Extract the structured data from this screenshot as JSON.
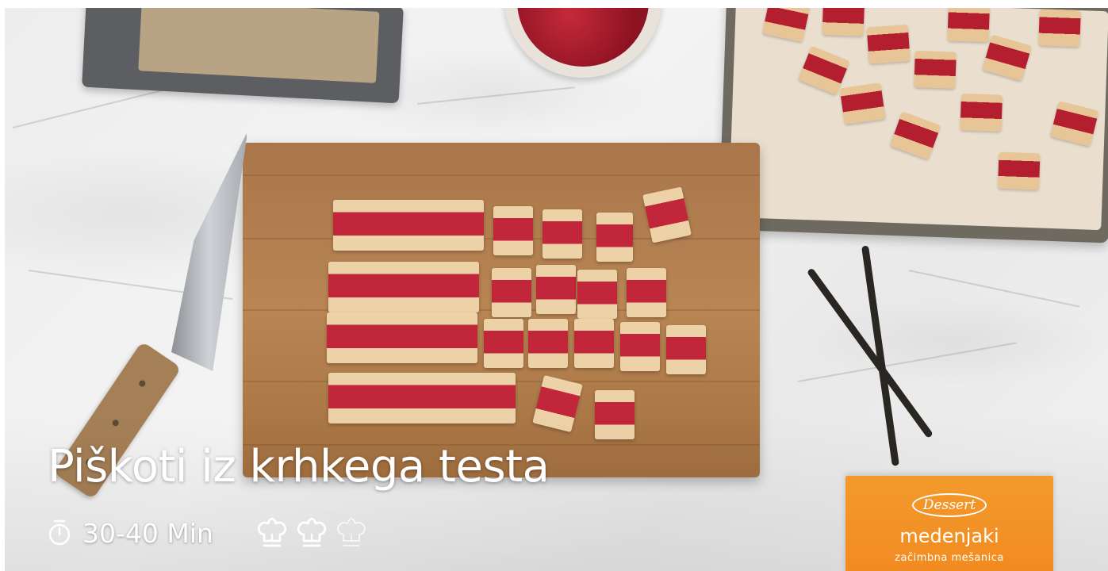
{
  "recipe": {
    "title": "Piškoti iz krhkega testa",
    "time": "30-40 Min",
    "time_icon": "timer-icon",
    "difficulty": {
      "level": 2,
      "max": 3,
      "icon": "chef-hat-icon"
    }
  },
  "product": {
    "brand": "Dessert",
    "name": "medenjaki",
    "subtitle": "začimbna mešanica"
  },
  "colors": {
    "overlay_text": "#ffffff",
    "pack_orange": "#f28a20",
    "jam_red": "#c1263a",
    "board_wood": "#b88553"
  }
}
